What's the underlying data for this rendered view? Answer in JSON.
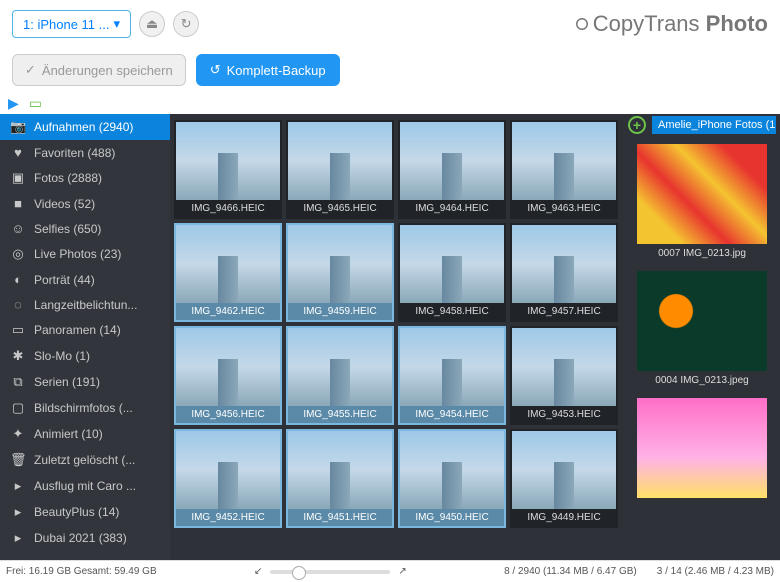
{
  "topbar": {
    "device": "1: iPhone 11 ..."
  },
  "brand": {
    "name": "CopyTrans",
    "suffix": "Photo"
  },
  "actions": {
    "save": "Änderungen speichern",
    "backup": "Komplett-Backup"
  },
  "sidebar": [
    {
      "icon": "camera",
      "label": "Aufnahmen (2940)",
      "active": true
    },
    {
      "icon": "heart",
      "label": "Favoriten (488)"
    },
    {
      "icon": "photo",
      "label": "Fotos (2888)"
    },
    {
      "icon": "video",
      "label": "Videos (52)"
    },
    {
      "icon": "selfie",
      "label": "Selfies (650)"
    },
    {
      "icon": "live",
      "label": "Live Photos (23)"
    },
    {
      "icon": "portrait",
      "label": "Porträt (44)"
    },
    {
      "icon": "longexp",
      "label": "Langzeitbelichtun..."
    },
    {
      "icon": "pano",
      "label": "Panoramen (14)"
    },
    {
      "icon": "slomo",
      "label": "Slo-Mo (1)"
    },
    {
      "icon": "burst",
      "label": "Serien (191)"
    },
    {
      "icon": "screen",
      "label": "Bildschirmfotos (..."
    },
    {
      "icon": "anim",
      "label": "Animiert (10)"
    },
    {
      "icon": "trash",
      "label": "Zuletzt gelöscht (..."
    },
    {
      "icon": "album",
      "label": "Ausflug mit Caro ..."
    },
    {
      "icon": "album",
      "label": "BeautyPlus (14)"
    },
    {
      "icon": "album",
      "label": "Dubai 2021 (383)"
    }
  ],
  "grid": [
    [
      {
        "n": "IMG_9466.HEIC"
      },
      {
        "n": "IMG_9465.HEIC"
      },
      {
        "n": "IMG_9464.HEIC"
      },
      {
        "n": "IMG_9463.HEIC"
      }
    ],
    [
      {
        "n": "IMG_9462.HEIC",
        "s": 1
      },
      {
        "n": "IMG_9459.HEIC",
        "s": 1
      },
      {
        "n": "IMG_9458.HEIC"
      },
      {
        "n": "IMG_9457.HEIC"
      }
    ],
    [
      {
        "n": "IMG_9456.HEIC",
        "s": 1
      },
      {
        "n": "IMG_9455.HEIC",
        "s": 1
      },
      {
        "n": "IMG_9454.HEIC",
        "s": 1
      },
      {
        "n": "IMG_9453.HEIC"
      }
    ],
    [
      {
        "n": "IMG_9452.HEIC",
        "s": 1
      },
      {
        "n": "IMG_9451.HEIC",
        "s": 1
      },
      {
        "n": "IMG_9450.HEIC",
        "s": 1
      },
      {
        "n": "IMG_9449.HEIC"
      }
    ]
  ],
  "right": {
    "tab": "Amelie_iPhone Fotos (1",
    "items": [
      {
        "label": "0007 IMG_0213.jpg",
        "cls": "tulips"
      },
      {
        "label": "0004 IMG_0213.jpeg",
        "cls": "oranges"
      },
      {
        "label": "",
        "cls": "pink"
      }
    ]
  },
  "status": {
    "left": "Frei: 16.19 GB Gesamt: 59.49 GB",
    "mid": "8 / 2940 (11.34 MB / 6.47 GB)",
    "right": "3 / 14 (2.46 MB / 4.23 MB)"
  }
}
